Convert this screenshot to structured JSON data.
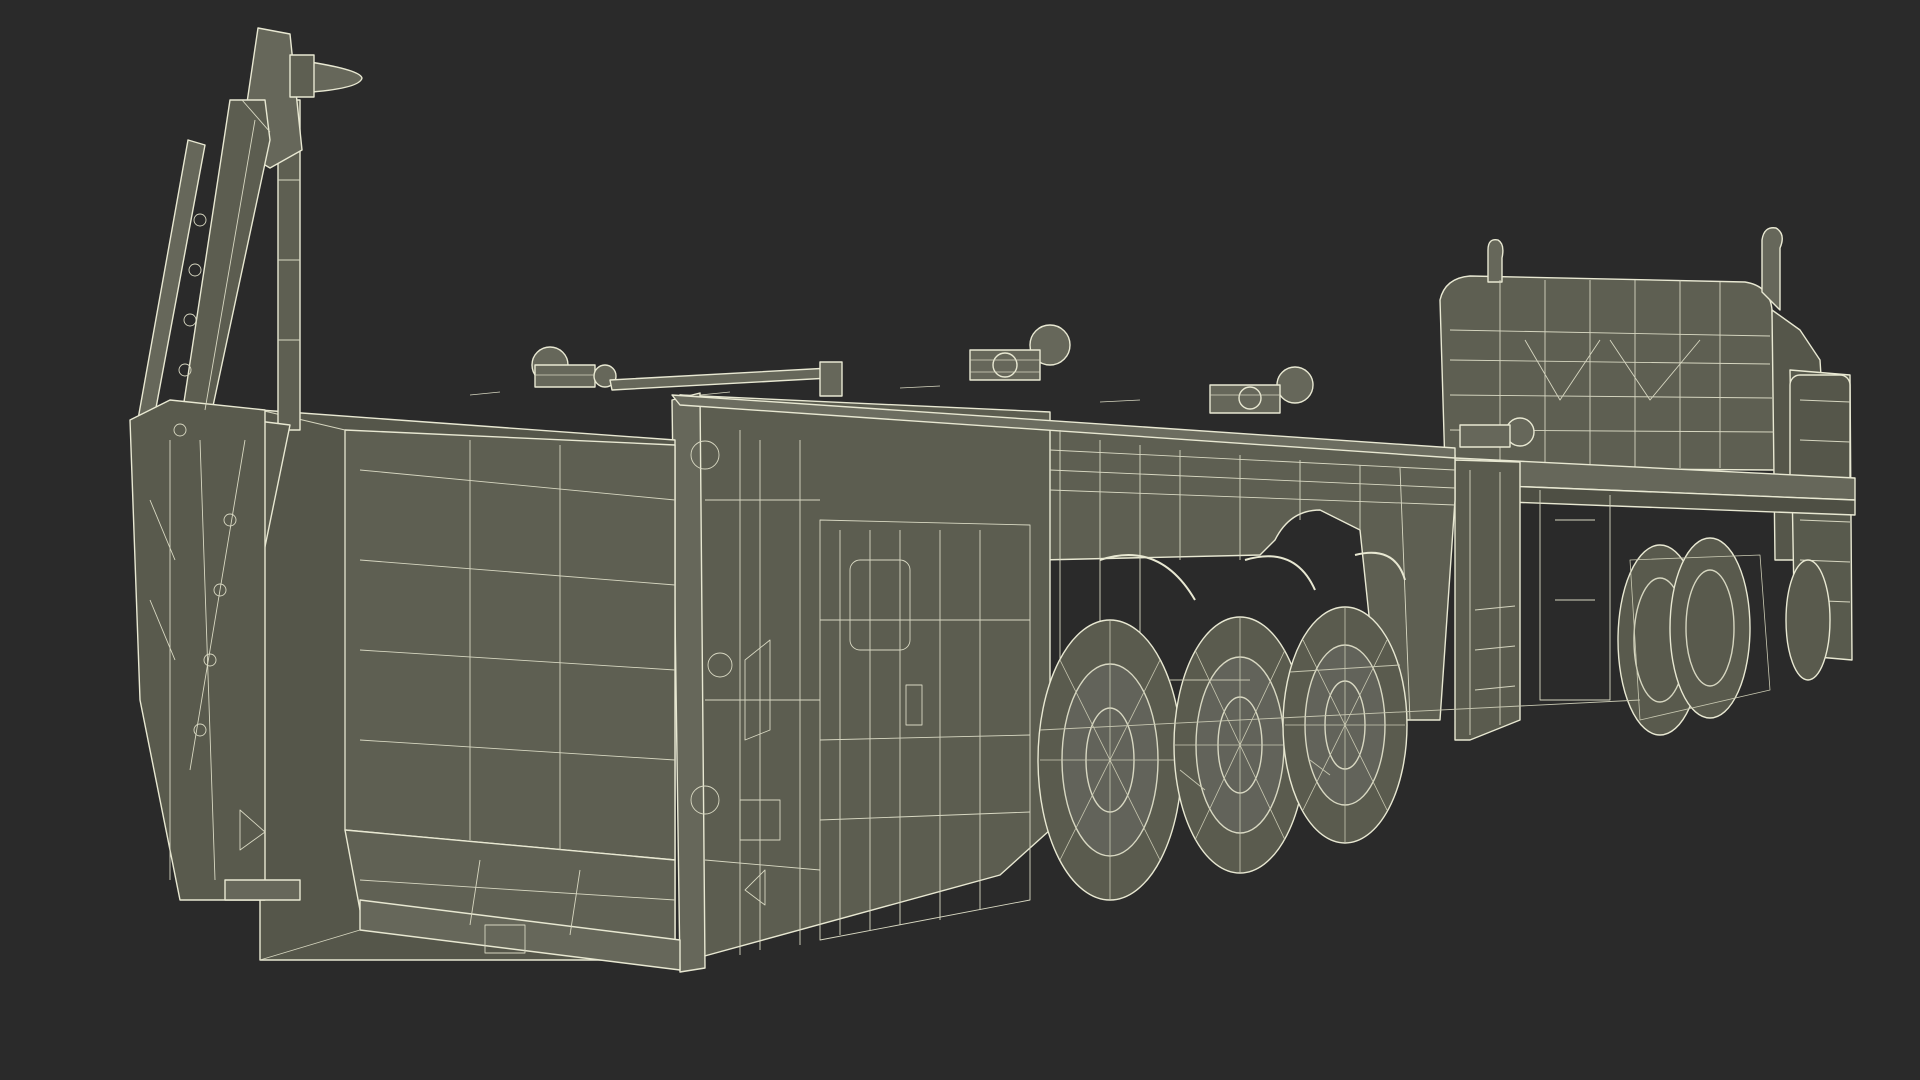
{
  "scene": {
    "background": "#2a2a2a",
    "body_fill": "#5c5d50",
    "body_fill_dark": "#4e4f44",
    "body_fill_light": "#66675a",
    "wire_color": "#e8e8d2",
    "wire_dim": "#b9b9a4"
  }
}
